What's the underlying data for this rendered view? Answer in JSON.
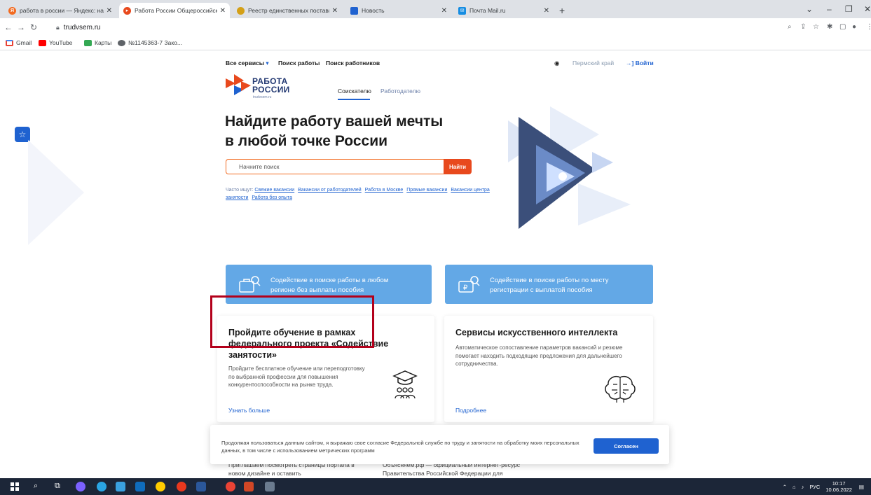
{
  "browser": {
    "tabs": [
      {
        "title": "работа в россии — Яндекс: най",
        "favicon_color": "#f26b21"
      },
      {
        "title": "Работа России Общероссийска",
        "favicon_color": "#e8491d"
      },
      {
        "title": "Реестр единственных поставщ",
        "favicon_color": "#d4a017"
      },
      {
        "title": "Новость",
        "favicon_color": "#1f62d0"
      },
      {
        "title": "Почта Mail.ru",
        "favicon_color": "#168de2"
      }
    ],
    "new_tab": "+",
    "close": "✕",
    "url": "trudvsem.ru",
    "bookmarks": [
      "Gmail",
      "YouTube",
      "Карты",
      "№1145363-7 Зако..."
    ]
  },
  "site": {
    "nav": {
      "all_services": "Все сервисы",
      "job_search": "Поиск работы",
      "worker_search": "Поиск работников",
      "region": "Пермский край",
      "login": "Войти"
    },
    "logo": {
      "line1": "РАБОТА",
      "line2": "РОССИИ",
      "domain": "trudvsem.ru"
    },
    "role_tabs": {
      "seeker": "Соискателю",
      "employer": "Работодателю"
    },
    "hero": {
      "title_line1": "Найдите работу вашей мечты",
      "title_line2": "в любой точке России",
      "search_placeholder": "Начните поиск",
      "search_button": "Найти"
    },
    "often_searched": {
      "label": "Часто ищут:",
      "links": [
        "Свежие вакансии",
        "Вакансии от работодателей",
        "Работа в Москве",
        "Прямые вакансии",
        "Вакансии центра занятости",
        "Работа без опыта"
      ]
    },
    "blue_cards": [
      {
        "line1": "Содействие в поиске работы в любом",
        "line2": "регионе без выплаты пособия"
      },
      {
        "line1": "Содействие в поиске работы по месту",
        "line2": "регистрации с выплатой пособия"
      }
    ],
    "cards": [
      {
        "title": "Пройдите обучение в рамках федерального проекта «Содействие занятости»",
        "text": "Пройдите бесплатное обучение или переподготовку по выбранной профессии для повышения конкурентоспособности на рынке труда.",
        "link": "Узнать больше"
      },
      {
        "title": "Сервисы искусственного интеллекта",
        "text": "Автоматическое сопоставление параметров вакансий и резюме помогает находить подходящие предложения для дальнейшего сотрудничества.",
        "link": "Подробнее"
      }
    ],
    "lower_cards": {
      "left": "Приглашаем посмотреть страницы портала в новом дизайне и оставить",
      "right": "Объясняем.рф — официальный интернет-ресурс Правительства Российской Федерации для"
    },
    "cookie": {
      "text": "Продолжая пользоваться данным сайтом, я выражаю свое согласие Федеральной службе по труду и занятости на обработку моих персональных данных, в том числе с использованием метрических программ",
      "button": "Согласен"
    }
  },
  "taskbar": {
    "lang": "РУС",
    "time": "10:17",
    "date": "10.06.2022"
  },
  "colors": {
    "brand_blue": "#1f62d0",
    "brand_orange": "#e8491d",
    "card_blue": "#63a8e6",
    "highlight_red": "#b3001b"
  }
}
